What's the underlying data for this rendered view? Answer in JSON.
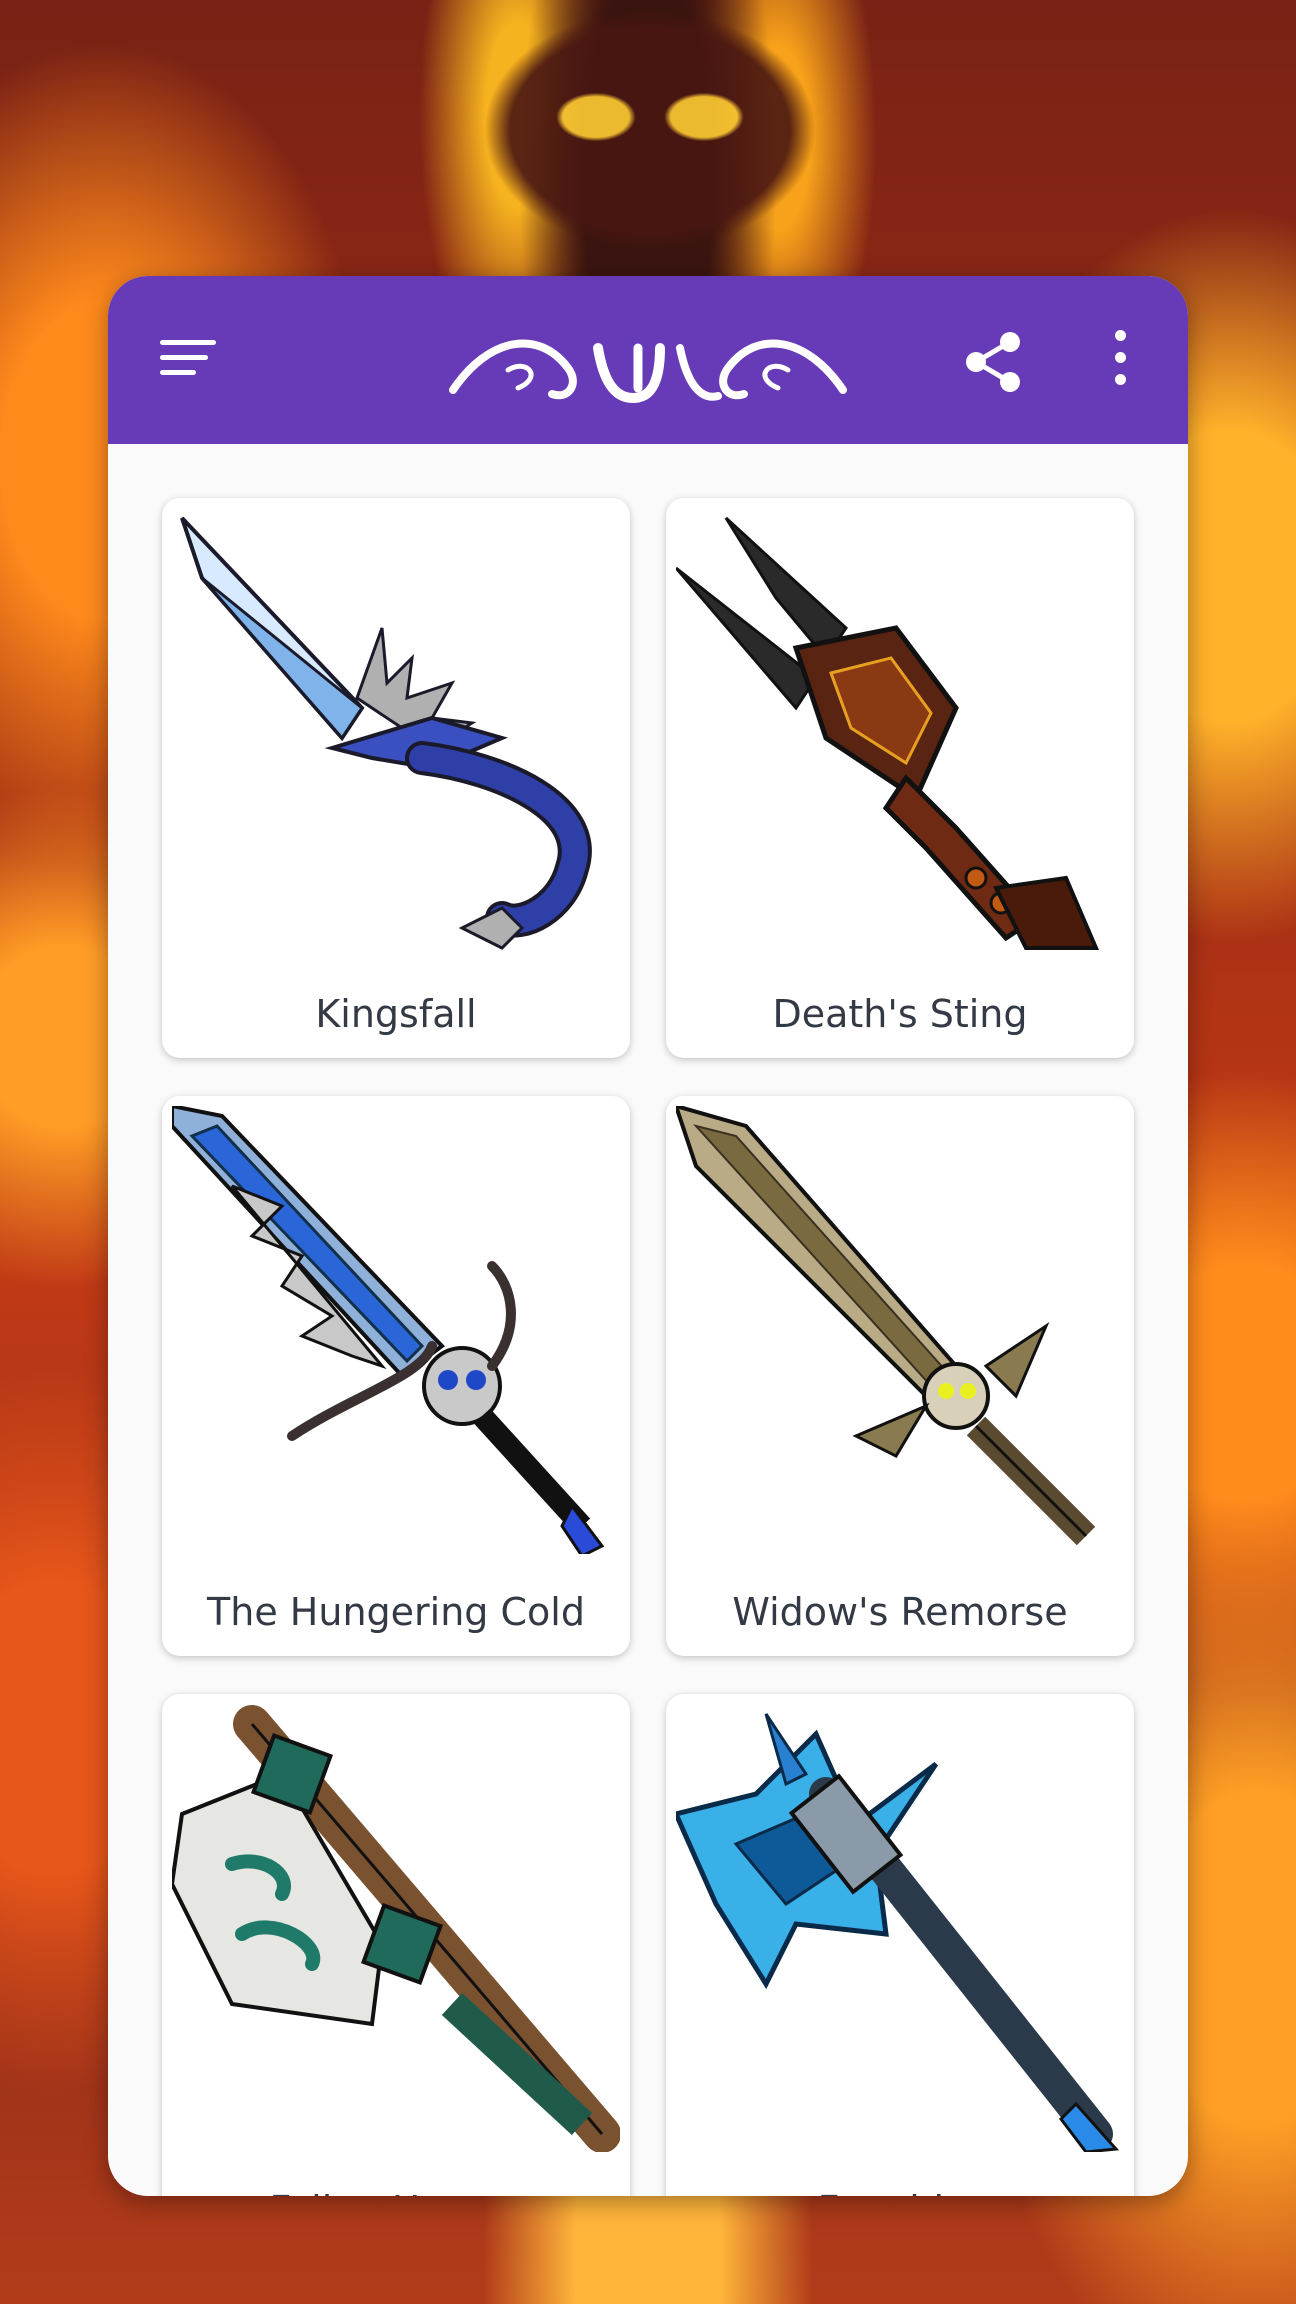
{
  "app": {
    "appbar_color": "#673ab7",
    "icons": {
      "menu": "menu-icon",
      "logo": "calligraphy-logo",
      "share": "share-icon",
      "more": "more-vert-icon"
    }
  },
  "items": [
    {
      "name": "Kingsfall",
      "icon": "ice-sword-image"
    },
    {
      "name": "Death's Sting",
      "icon": "dark-trident-sword-image"
    },
    {
      "name": "The Hungering Cold",
      "icon": "frost-skull-sword-image"
    },
    {
      "name": "Widow's Remorse",
      "icon": "skull-bronze-sword-image"
    },
    {
      "name": "Fallen Hunter",
      "icon": "stone-axe-image"
    },
    {
      "name": "Frostbite",
      "icon": "ice-axe-image"
    }
  ]
}
